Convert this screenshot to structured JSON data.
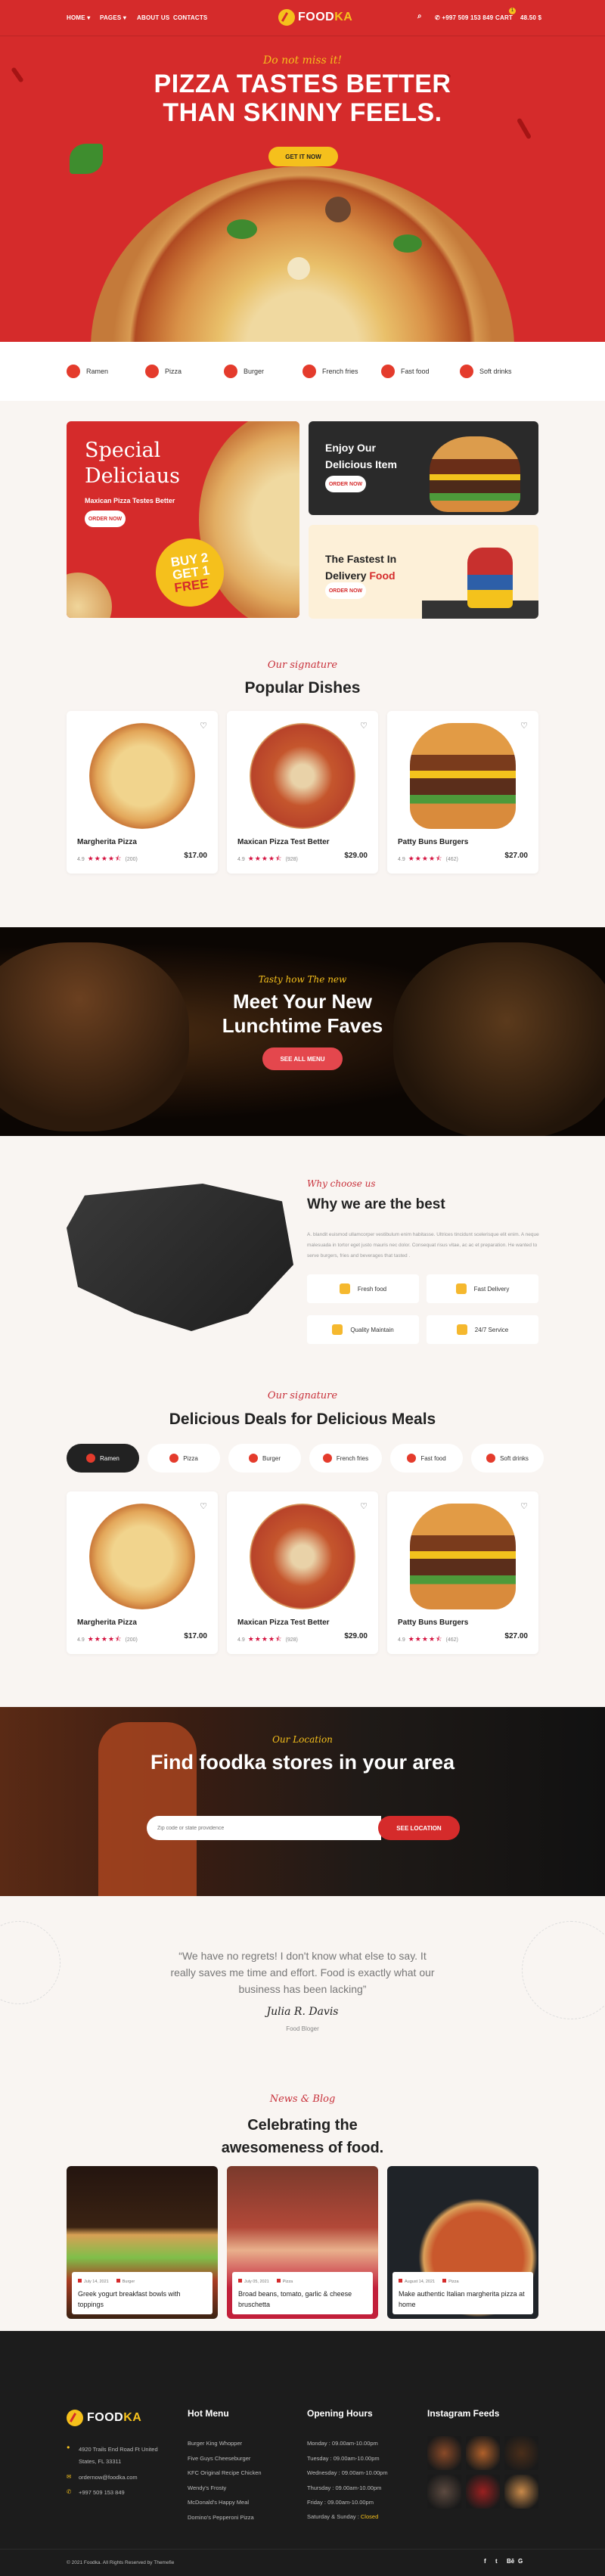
{
  "colors": {
    "brand_red": "#d52b2b",
    "brand_yellow": "#f5c01c",
    "dark": "#1c1c1c",
    "cream": "#f9f5f2",
    "star": "#d4123f"
  },
  "header": {
    "nav": [
      {
        "label": "HOME",
        "has_dropdown": true
      },
      {
        "label": "PAGES",
        "has_dropdown": true
      },
      {
        "label": "ABOUT US"
      },
      {
        "label": "CONTACTS"
      }
    ],
    "logo": {
      "part1": "FOOD",
      "part2": "KA"
    },
    "phone": "+997 509 153 849",
    "cart_label": "CART",
    "cart_count": "1",
    "cart_total": "48.50 $",
    "icons": {
      "search": "search-icon",
      "phone": "phone-icon"
    }
  },
  "hero": {
    "kicker": "Do not miss it!",
    "title_line1": "PIZZA TASTES BETTER",
    "title_line2": "THAN SKINNY FEELS.",
    "cta": "GET IT NOW"
  },
  "categories": [
    "Ramen",
    "Pizza",
    "Burger",
    "French fries",
    "Fast food",
    "Soft drinks"
  ],
  "promos": {
    "special": {
      "title_line1": "Special",
      "title_line2": "Deliciaus",
      "subtitle": "Maxican Pizza Testes Better",
      "cta": "ORDER NOW",
      "badge_line1": "BUY 2",
      "badge_line2": "GET 1",
      "badge_line3": "FREE"
    },
    "enjoy": {
      "title_line1": "Enjoy Our",
      "title_line2": "Delicious Item",
      "cta": "ORDER NOW"
    },
    "delivery": {
      "title_line1": "The Fastest In",
      "title_line2a": "Delivery ",
      "title_line2b": "Food",
      "cta": "ORDER NOW"
    }
  },
  "popular": {
    "kicker": "Our signature",
    "title": "Popular Dishes",
    "items": [
      {
        "name": "Margherita Pizza",
        "rating": "4.9",
        "stars": 4.5,
        "reviews": "(200)",
        "price": "$17.00"
      },
      {
        "name": "Maxican Pizza Test Better",
        "rating": "4.9",
        "stars": 4.5,
        "reviews": "(928)",
        "price": "$29.00"
      },
      {
        "name": "Patty Buns Burgers",
        "rating": "4.9",
        "stars": 4.5,
        "reviews": "(462)",
        "price": "$27.00"
      }
    ]
  },
  "lunch": {
    "kicker": "Tasty how The new",
    "title_line1": "Meet Your New",
    "title_line2": "Lunchtime Faves",
    "cta": "SEE ALL MENU"
  },
  "why": {
    "kicker": "Why choose us",
    "title": "Why we are the best",
    "body": "A. blandit euismod ullamcorper vestibulum enim habitasse. Ultrices tincidunt scelerisque elit enim. A neque malesuada in tortor eget justo mauris nec dolor. Consequat risus vitae, ac ac et preparation. He wanted to serve burgers, fries and beverages that tasted .",
    "features": [
      "Fresh food",
      "Fast Delivery",
      "Quality Maintain",
      "24/7 Service"
    ]
  },
  "deals": {
    "kicker": "Our signature",
    "title": "Delicious Deals for Delicious Meals",
    "tabs": [
      "Ramen",
      "Pizza",
      "Burger",
      "French fries",
      "Fast food",
      "Soft drinks"
    ],
    "active_tab": "Ramen",
    "items": [
      {
        "name": "Margherita Pizza",
        "rating": "4.9",
        "stars": 4.5,
        "reviews": "(200)",
        "price": "$17.00"
      },
      {
        "name": "Maxican Pizza Test Better",
        "rating": "4.9",
        "stars": 4.5,
        "reviews": "(928)",
        "price": "$29.00"
      },
      {
        "name": "Patty Buns Burgers",
        "rating": "4.9",
        "stars": 4.5,
        "reviews": "(462)",
        "price": "$27.00"
      }
    ]
  },
  "location": {
    "kicker": "Our Location",
    "title": "Find foodka stores in your area",
    "placeholder": "Zip code or state providence",
    "cta": "SEE LOCATION"
  },
  "testimonial": {
    "quote": "“We have no regrets! I don't know what else to say. It really saves me time and effort. Food is exactly what our business has been lacking”",
    "name": "Julia R. Davis",
    "role": "Food Bloger"
  },
  "blog": {
    "kicker": "News & Blog",
    "title_line1": "Celebrating the",
    "title_line2": "awesomeness of food.",
    "posts": [
      {
        "date": "July 14, 2021",
        "category": "Burger",
        "title": "Greek yogurt breakfast bowls with toppings"
      },
      {
        "date": "July 05, 2021",
        "category": "Pizza",
        "title": "Broad beans, tomato, garlic & cheese bruschetta"
      },
      {
        "date": "August 14, 2021",
        "category": "Pizza",
        "title": "Make authentic Italian margherita pizza at home"
      }
    ]
  },
  "footer": {
    "address": "4920 Trails End Road Ft United States, FL 33311",
    "email": "ordernow@foodka.com",
    "phone": "+997 509 153 849",
    "hot_menu_title": "Hot Menu",
    "hot_menu": [
      "Burger King Whopper",
      "Five Guys Cheeseburger",
      "KFC Original Recipe Chicken",
      "Wendy's Frosty",
      "McDonald's Happy Meal",
      "Domino's Pepperoni Pizza"
    ],
    "hours_title": "Opening Hours",
    "hours": [
      {
        "label": "Monday : 09.00am-10.00pm"
      },
      {
        "label": "Tuesday : 09.00am-10.00pm"
      },
      {
        "label": "Wednesday : 09.00am-10.00pm"
      },
      {
        "label": "Thursday : 09.00am-10.00pm"
      },
      {
        "label": "Friday : 09.00am-10.00pm"
      }
    ],
    "weekend_label": "Saturday & Sunday : ",
    "weekend_value": "Closed",
    "instagram_title": "Instagram Feeds",
    "copyright": "© 2021 Foodka. All Rights Reserved by Themefie",
    "social": [
      {
        "icon": "facebook-icon",
        "glyph": "f"
      },
      {
        "icon": "twitter-icon",
        "glyph": "t"
      },
      {
        "icon": "behance-icon",
        "glyph": "Bē"
      },
      {
        "icon": "google-icon",
        "glyph": "G"
      }
    ]
  }
}
